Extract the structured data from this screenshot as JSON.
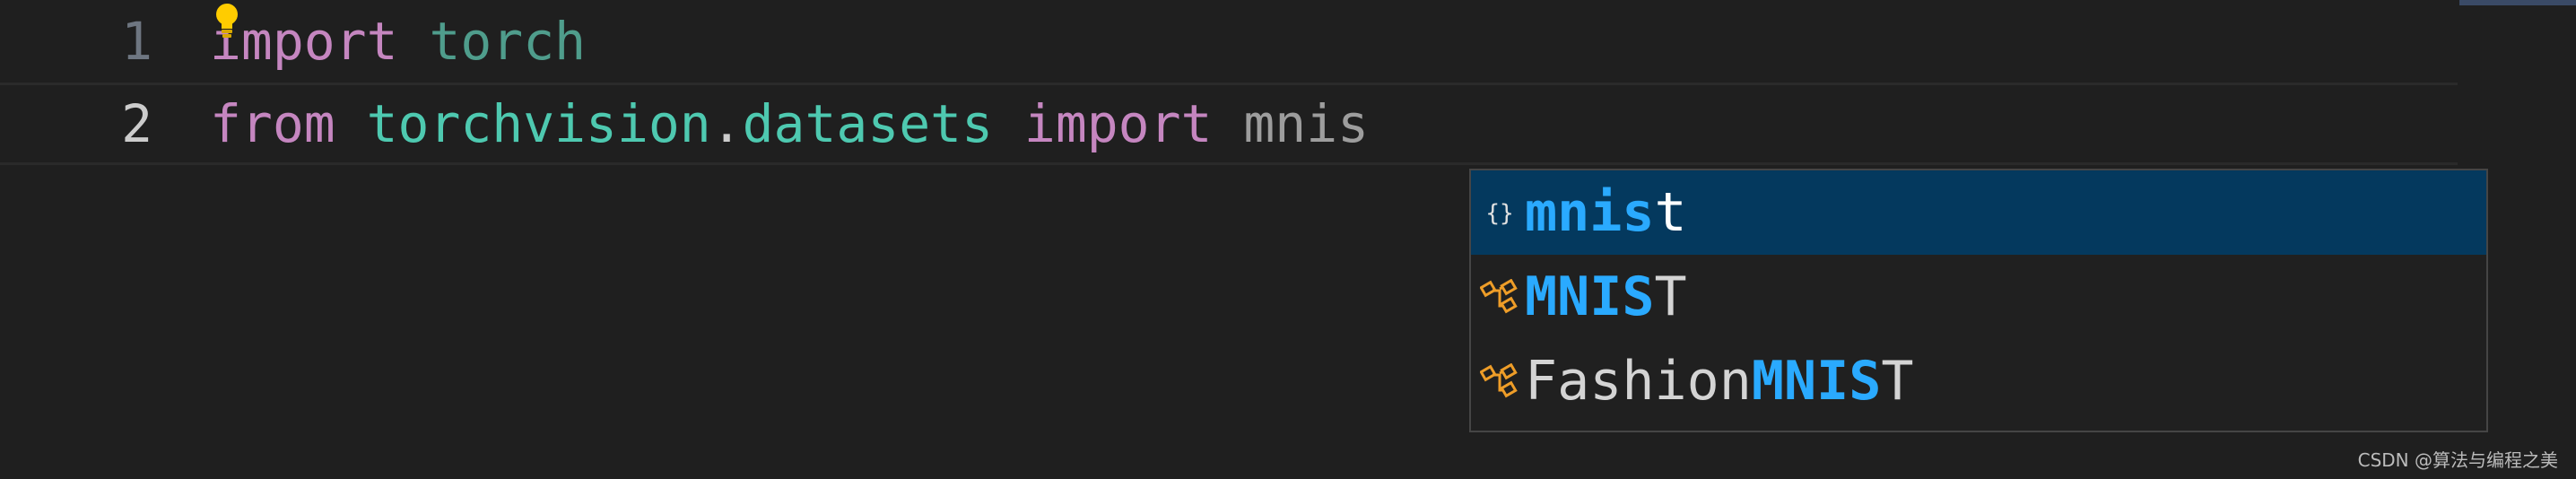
{
  "editor": {
    "lines": [
      {
        "number": "1",
        "tokens": {
          "t1": "import",
          "t2": " ",
          "t3": "torch"
        }
      },
      {
        "number": "2",
        "tokens": {
          "t1": "from",
          "t2": " ",
          "t3": "torchvision",
          "t4": ".",
          "t5": "datasets",
          "t6": " ",
          "t7": "import",
          "t8": " ",
          "t9": "mnis"
        }
      }
    ],
    "lightbulb_icon": "lightbulb-icon"
  },
  "suggestions": {
    "items": [
      {
        "icon": "module-icon",
        "match": "mnis",
        "rest": "t",
        "prefix": "",
        "selected": true
      },
      {
        "icon": "class-icon",
        "match": "MNIS",
        "rest": "T",
        "prefix": "",
        "selected": false
      },
      {
        "icon": "class-icon",
        "prefix": "Fashion",
        "match": "MNIS",
        "rest": "T",
        "selected": false
      }
    ]
  },
  "watermark": "CSDN @算法与编程之美",
  "colors": {
    "background": "#1f1f1f",
    "keyword": "#c586c0",
    "module": "#4ec9b0",
    "highlight": "#2aaaff",
    "selection": "#04395e",
    "class_icon": "#ee9d28"
  }
}
